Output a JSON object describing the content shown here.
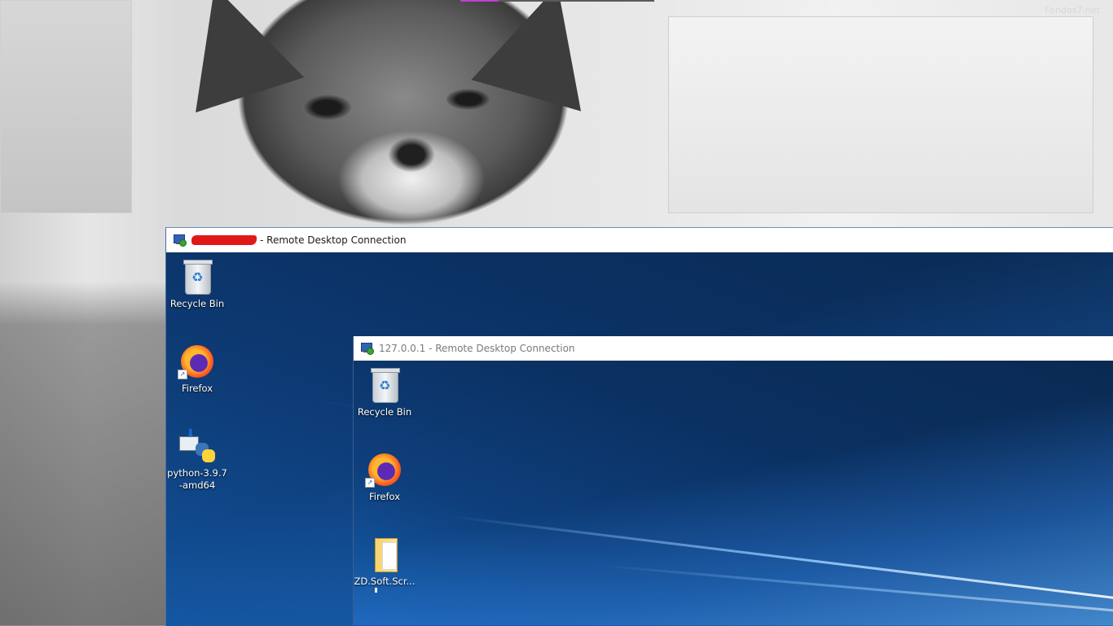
{
  "host": {
    "watermark": "Fondos7.net"
  },
  "outer_window": {
    "title_redacted": true,
    "title_suffix": "- Remote Desktop Connection",
    "desktop_icons": [
      {
        "label": "Recycle Bin",
        "icon": "recycle-bin-icon"
      },
      {
        "label": "Firefox",
        "icon": "firefox-icon"
      },
      {
        "label": "python-3.9.7\n-amd64",
        "label_line1": "python-3.9.7",
        "label_line2": "-amd64",
        "icon": "python-installer-icon"
      }
    ]
  },
  "inner_window": {
    "title": "127.0.0.1 - Remote Desktop Connection",
    "desktop_icons": [
      {
        "label": "Recycle Bin",
        "icon": "recycle-bin-icon"
      },
      {
        "label": "Firefox",
        "icon": "firefox-icon"
      },
      {
        "label": "ZD.Soft.Scr...",
        "icon": "folder-icon"
      }
    ]
  },
  "colors": {
    "desktop_blue": "#0c2c56",
    "redaction": "#e01818",
    "titlebar": "#ffffff"
  }
}
